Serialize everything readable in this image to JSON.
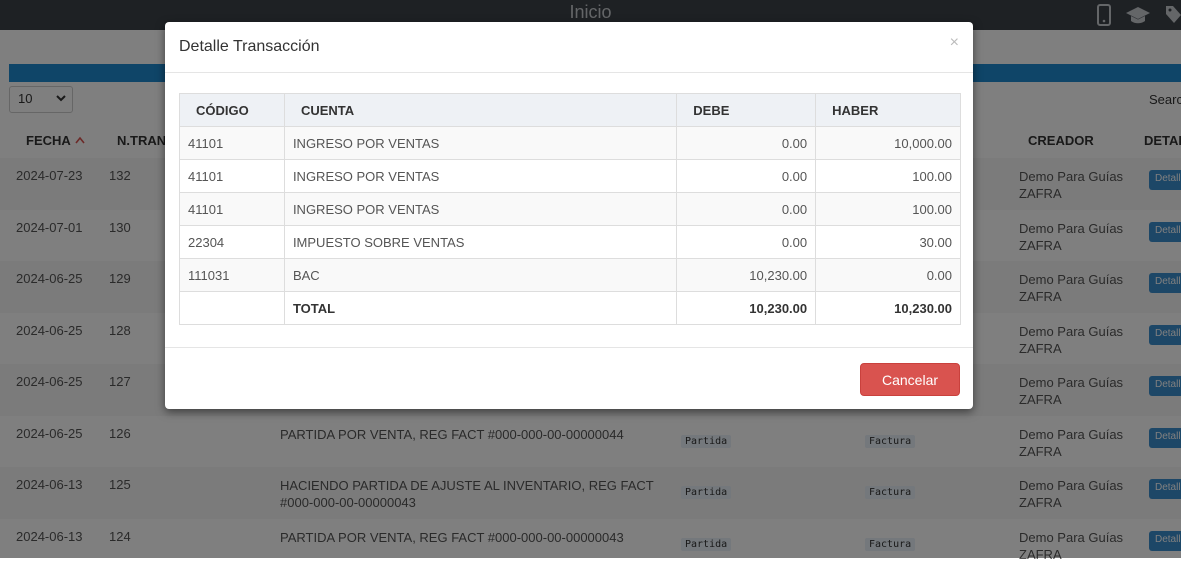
{
  "topbar": {
    "title": "Inicio",
    "icons": [
      "mobile-icon",
      "graduation-cap-icon",
      "tag-icon"
    ]
  },
  "page_size": {
    "value": "10"
  },
  "search": {
    "label": "Search:"
  },
  "bg_table": {
    "headers": {
      "fecha": "FECHA",
      "ntrans": "N.TRANS",
      "creador": "CREADOR",
      "detalle": "DETALLE"
    },
    "rows": [
      {
        "fecha": "2024-07-23",
        "num": "132",
        "desc": "",
        "tipo": "",
        "ref": "",
        "creator": "Demo Para Guías ZAFRA",
        "btn": "Detalle"
      },
      {
        "fecha": "2024-07-01",
        "num": "130",
        "desc": "",
        "tipo": "",
        "ref": "",
        "creator": "Demo Para Guías ZAFRA",
        "btn": "Detalle"
      },
      {
        "fecha": "2024-06-25",
        "num": "129",
        "desc": "",
        "tipo": "",
        "ref": "",
        "creator": "Demo Para Guías ZAFRA",
        "btn": "Detalle"
      },
      {
        "fecha": "2024-06-25",
        "num": "128",
        "desc": "",
        "tipo": "",
        "ref": "",
        "creator": "Demo Para Guías ZAFRA",
        "btn": "Detalle"
      },
      {
        "fecha": "2024-06-25",
        "num": "127",
        "desc": "",
        "tipo": "",
        "ref": "",
        "creator": "Demo Para Guías ZAFRA",
        "btn": "Detalle"
      },
      {
        "fecha": "2024-06-25",
        "num": "126",
        "desc": "PARTIDA POR VENTA, REG FACT #000-000-00-00000044",
        "tipo": "Partida",
        "ref": "Factura",
        "creator": "Demo Para Guías ZAFRA",
        "btn": "Detalle"
      },
      {
        "fecha": "2024-06-13",
        "num": "125",
        "desc": "HACIENDO PARTIDA DE AJUSTE AL INVENTARIO, REG FACT #000-000-00-00000043",
        "tipo": "Partida",
        "ref": "Factura",
        "creator": "Demo Para Guías ZAFRA",
        "btn": "Detalle"
      },
      {
        "fecha": "2024-06-13",
        "num": "124",
        "desc": "PARTIDA POR VENTA, REG FACT #000-000-00-00000043",
        "tipo": "Partida",
        "ref": "Factura",
        "creator": "Demo Para Guías ZAFRA",
        "btn": "Detalle"
      }
    ]
  },
  "modal": {
    "title": "Detalle Transacción",
    "close": "×",
    "headers": {
      "codigo": "CÓDIGO",
      "cuenta": "CUENTA",
      "debe": "DEBE",
      "haber": "HABER"
    },
    "rows": [
      {
        "codigo": "41101",
        "cuenta": "INGRESO POR VENTAS",
        "debe": "0.00",
        "haber": "10,000.00"
      },
      {
        "codigo": "41101",
        "cuenta": "INGRESO POR VENTAS",
        "debe": "0.00",
        "haber": "100.00"
      },
      {
        "codigo": "41101",
        "cuenta": "INGRESO POR VENTAS",
        "debe": "0.00",
        "haber": "100.00"
      },
      {
        "codigo": "22304",
        "cuenta": "IMPUESTO SOBRE VENTAS",
        "debe": "0.00",
        "haber": "30.00"
      },
      {
        "codigo": "111031",
        "cuenta": "BAC",
        "debe": "10,230.00",
        "haber": "0.00"
      }
    ],
    "total": {
      "label": "TOTAL",
      "debe": "10,230.00",
      "haber": "10,230.00"
    },
    "cancel_label": "Cancelar",
    "colors": {
      "cancel": "#d9534f",
      "accent": "#1f8bd1"
    }
  }
}
